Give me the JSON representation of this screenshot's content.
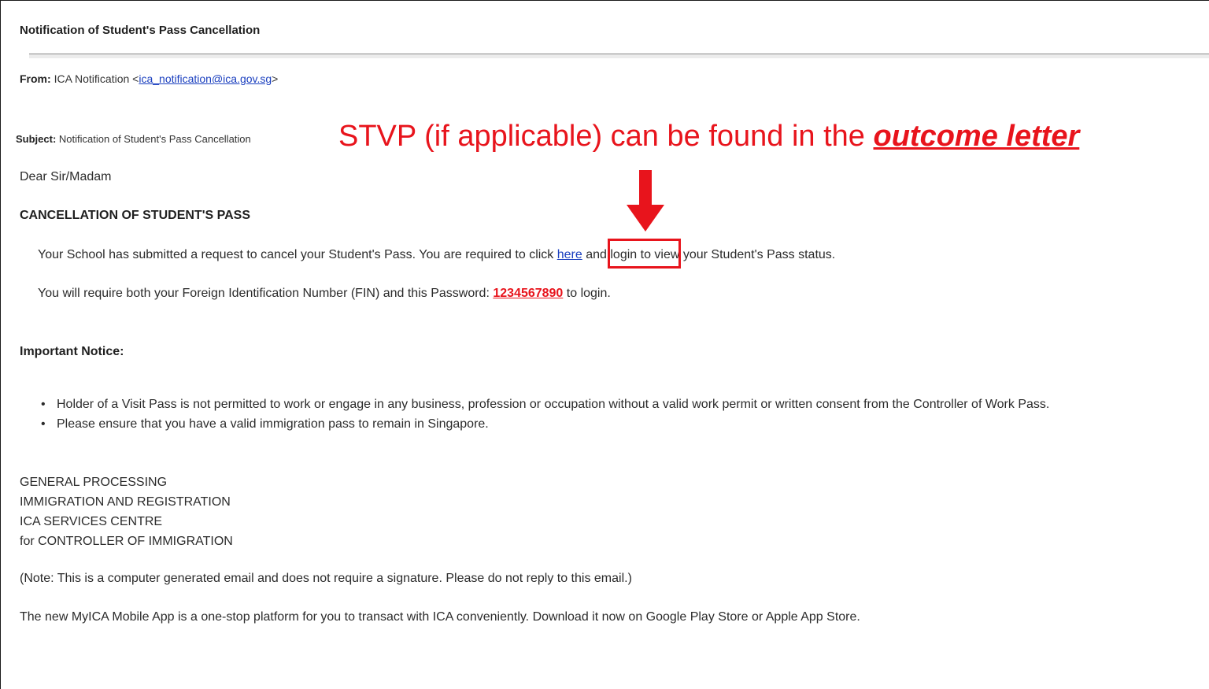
{
  "email": {
    "title": "Notification of Student's Pass Cancellation",
    "from_label": "From:",
    "from_name": "ICA Notification <",
    "from_address": "ica_notification@ica.gov.sg",
    "from_close": ">",
    "subject_label": "Subject:",
    "subject_value": "Notification of Student's Pass Cancellation",
    "greeting": "Dear Sir/Madam",
    "heading": "CANCELLATION OF STUDENT'S PASS",
    "para1_before": "Your School has submitted a request to cancel your Student's Pass. You are required to click ",
    "para1_link": "here",
    "para1_after": " and login to view your Student's Pass status.",
    "para2_before": "You will require both your Foreign Identification Number (FIN) and this Password: ",
    "password": "1234567890",
    "para2_after": "  to login.",
    "notice_heading": "Important Notice:",
    "notices": [
      "Holder of a Visit Pass is not permitted to work or engage in any business, profession or occupation without a valid work permit or written consent from the Controller of Work Pass.",
      "Please ensure that you have a valid immigration pass to remain in Singapore."
    ],
    "signature": [
      "GENERAL PROCESSING",
      "IMMIGRATION AND  REGISTRATION",
      "ICA SERVICES CENTRE",
      "for CONTROLLER OF IMMIGRATION"
    ],
    "note": "(Note: This is a computer generated email and does not require a signature. Please do not reply to this email.)",
    "app_promo": "The new MyICA Mobile App is a one-stop platform for you to transact with ICA conveniently. Download it now on Google Play Store or Apple App Store."
  },
  "annotation": {
    "text_before": "STVP (if applicable) can be found in the ",
    "text_emphasis": "outcome letter",
    "color": "#e8141c",
    "arrow_icon": "down-arrow-icon"
  }
}
